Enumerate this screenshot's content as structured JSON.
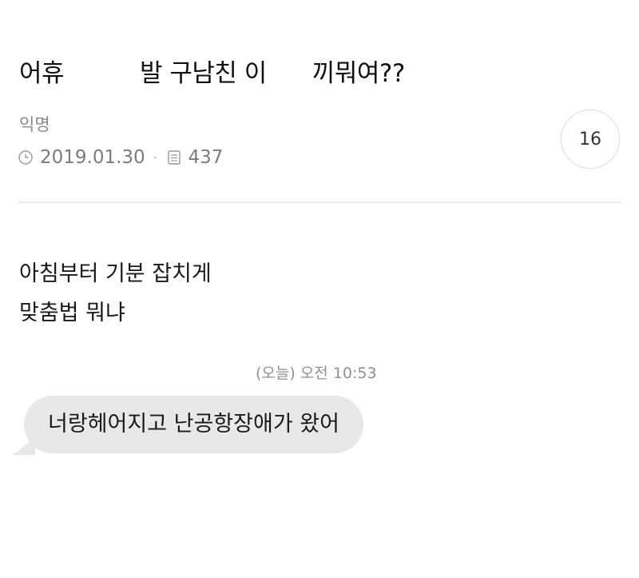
{
  "post": {
    "title": "어휴 ᅠᅠᅠ발 구남친 이ᅠᅠ끼뭐여??",
    "author": "익명",
    "date": "2019.01.30",
    "views": "437",
    "comment_count": "16",
    "icons": {
      "date": "clock-icon",
      "views": "document-icon"
    }
  },
  "content": {
    "lines": [
      "아침부터 기분 잡치게",
      "맞춤법 뭐냐"
    ]
  },
  "chat": {
    "timestamp": "(오늘) 오전 10:53",
    "message": "너랑헤어지고 난공항장애가 왔어",
    "bubble_color": "#e8e8ea"
  }
}
